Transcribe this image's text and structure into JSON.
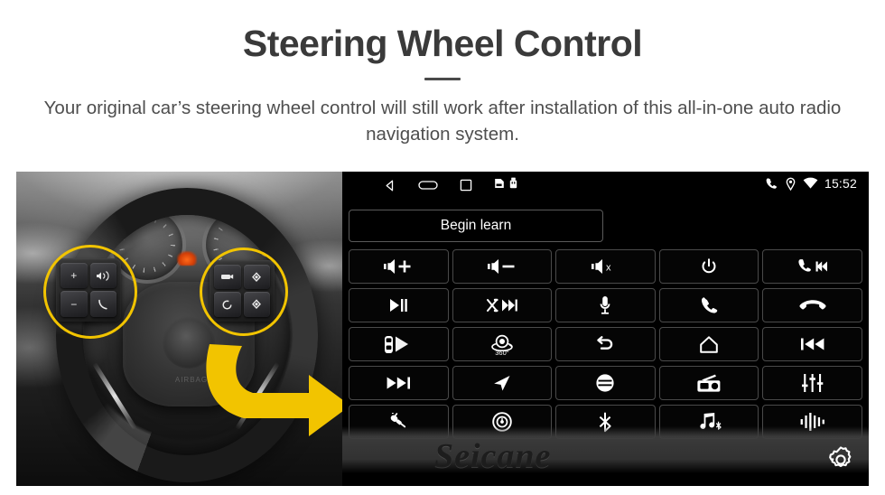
{
  "header": {
    "title": "Steering Wheel Control",
    "subtitle": "Your original car’s steering wheel control will still work after installation of this all-in-one auto radio navigation system."
  },
  "colors": {
    "highlight": "#f2c400",
    "arrow": "#f2c400",
    "title": "#3a3a3a",
    "subtitle": "#4e4e4e",
    "screen_bg": "#000000",
    "button_border": "#4a4a4a",
    "watermark": "#1d1d1d"
  },
  "photo": {
    "alt": "Car steering wheel with original steering wheel control buttons highlighted",
    "highlight_left": "left-swc-button-cluster",
    "highlight_right": "right-swc-button-cluster",
    "arrow": "curved-arrow-to-head-unit",
    "left_keys": [
      "volume-up-key",
      "voice-key",
      "volume-down-key",
      "phone-key"
    ],
    "right_keys": [
      "display-key",
      "up-arrow-key",
      "cruise-key",
      "down-arrow-key"
    ],
    "hub_label": "AIRBAG"
  },
  "head_unit": {
    "status_bar": {
      "nav_icons": [
        "back-icon",
        "home-icon",
        "recents-icon"
      ],
      "storage_icons": [
        "sd-card-icon",
        "usb-icon"
      ],
      "right_icons": [
        "phone-signal-icon",
        "location-icon",
        "wifi-icon"
      ],
      "time": "15:52"
    },
    "begin_learn_label": "Begin learn",
    "watermark": "Seicane",
    "settings_icon": "gear-icon",
    "buttons": [
      {
        "id": "volume-up",
        "icon": "volume-up-icon",
        "label": "Volume +"
      },
      {
        "id": "volume-down",
        "icon": "volume-down-icon",
        "label": "Volume −"
      },
      {
        "id": "mute",
        "icon": "volume-mute-icon",
        "label": "Mute"
      },
      {
        "id": "power",
        "icon": "power-icon",
        "label": "Power"
      },
      {
        "id": "call-prev",
        "icon": "call-previous-icon",
        "label": "Call / Previous"
      },
      {
        "id": "play-pause",
        "icon": "play-pause-icon",
        "label": "Play / Pause"
      },
      {
        "id": "shuffle-next",
        "icon": "shuffle-next-icon",
        "label": "Shuffle / Next"
      },
      {
        "id": "voice",
        "icon": "microphone-icon",
        "label": "Voice"
      },
      {
        "id": "answer-call",
        "icon": "phone-answer-icon",
        "label": "Answer"
      },
      {
        "id": "hang-up",
        "icon": "phone-hangup-icon",
        "label": "Hang up"
      },
      {
        "id": "parking-sensor",
        "icon": "parking-radar-icon",
        "label": "Parking sensor"
      },
      {
        "id": "camera-360",
        "icon": "camera-360-icon",
        "label": "360° camera"
      },
      {
        "id": "back",
        "icon": "back-arrow-icon",
        "label": "Back"
      },
      {
        "id": "home",
        "icon": "house-icon",
        "label": "Home"
      },
      {
        "id": "previous-track",
        "icon": "previous-track-icon",
        "label": "Previous"
      },
      {
        "id": "next-track",
        "icon": "next-track-icon",
        "label": "Next"
      },
      {
        "id": "navigation",
        "icon": "navigation-arrow-icon",
        "label": "Navigation"
      },
      {
        "id": "source-switch",
        "icon": "source-switch-icon",
        "label": "Source"
      },
      {
        "id": "radio",
        "icon": "radio-icon",
        "label": "Radio"
      },
      {
        "id": "equalizer",
        "icon": "equalizer-icon",
        "label": "Equalizer"
      },
      {
        "id": "aux",
        "icon": "aux-plug-icon",
        "label": "AUX"
      },
      {
        "id": "disc",
        "icon": "disc-icon",
        "label": "Disc"
      },
      {
        "id": "bluetooth",
        "icon": "bluetooth-icon",
        "label": "Bluetooth"
      },
      {
        "id": "bluetooth-music",
        "icon": "bluetooth-music-icon",
        "label": "BT Music"
      },
      {
        "id": "voice-wave",
        "icon": "voice-wave-icon",
        "label": "Voice wave"
      }
    ],
    "camera_360_label": "360°"
  }
}
